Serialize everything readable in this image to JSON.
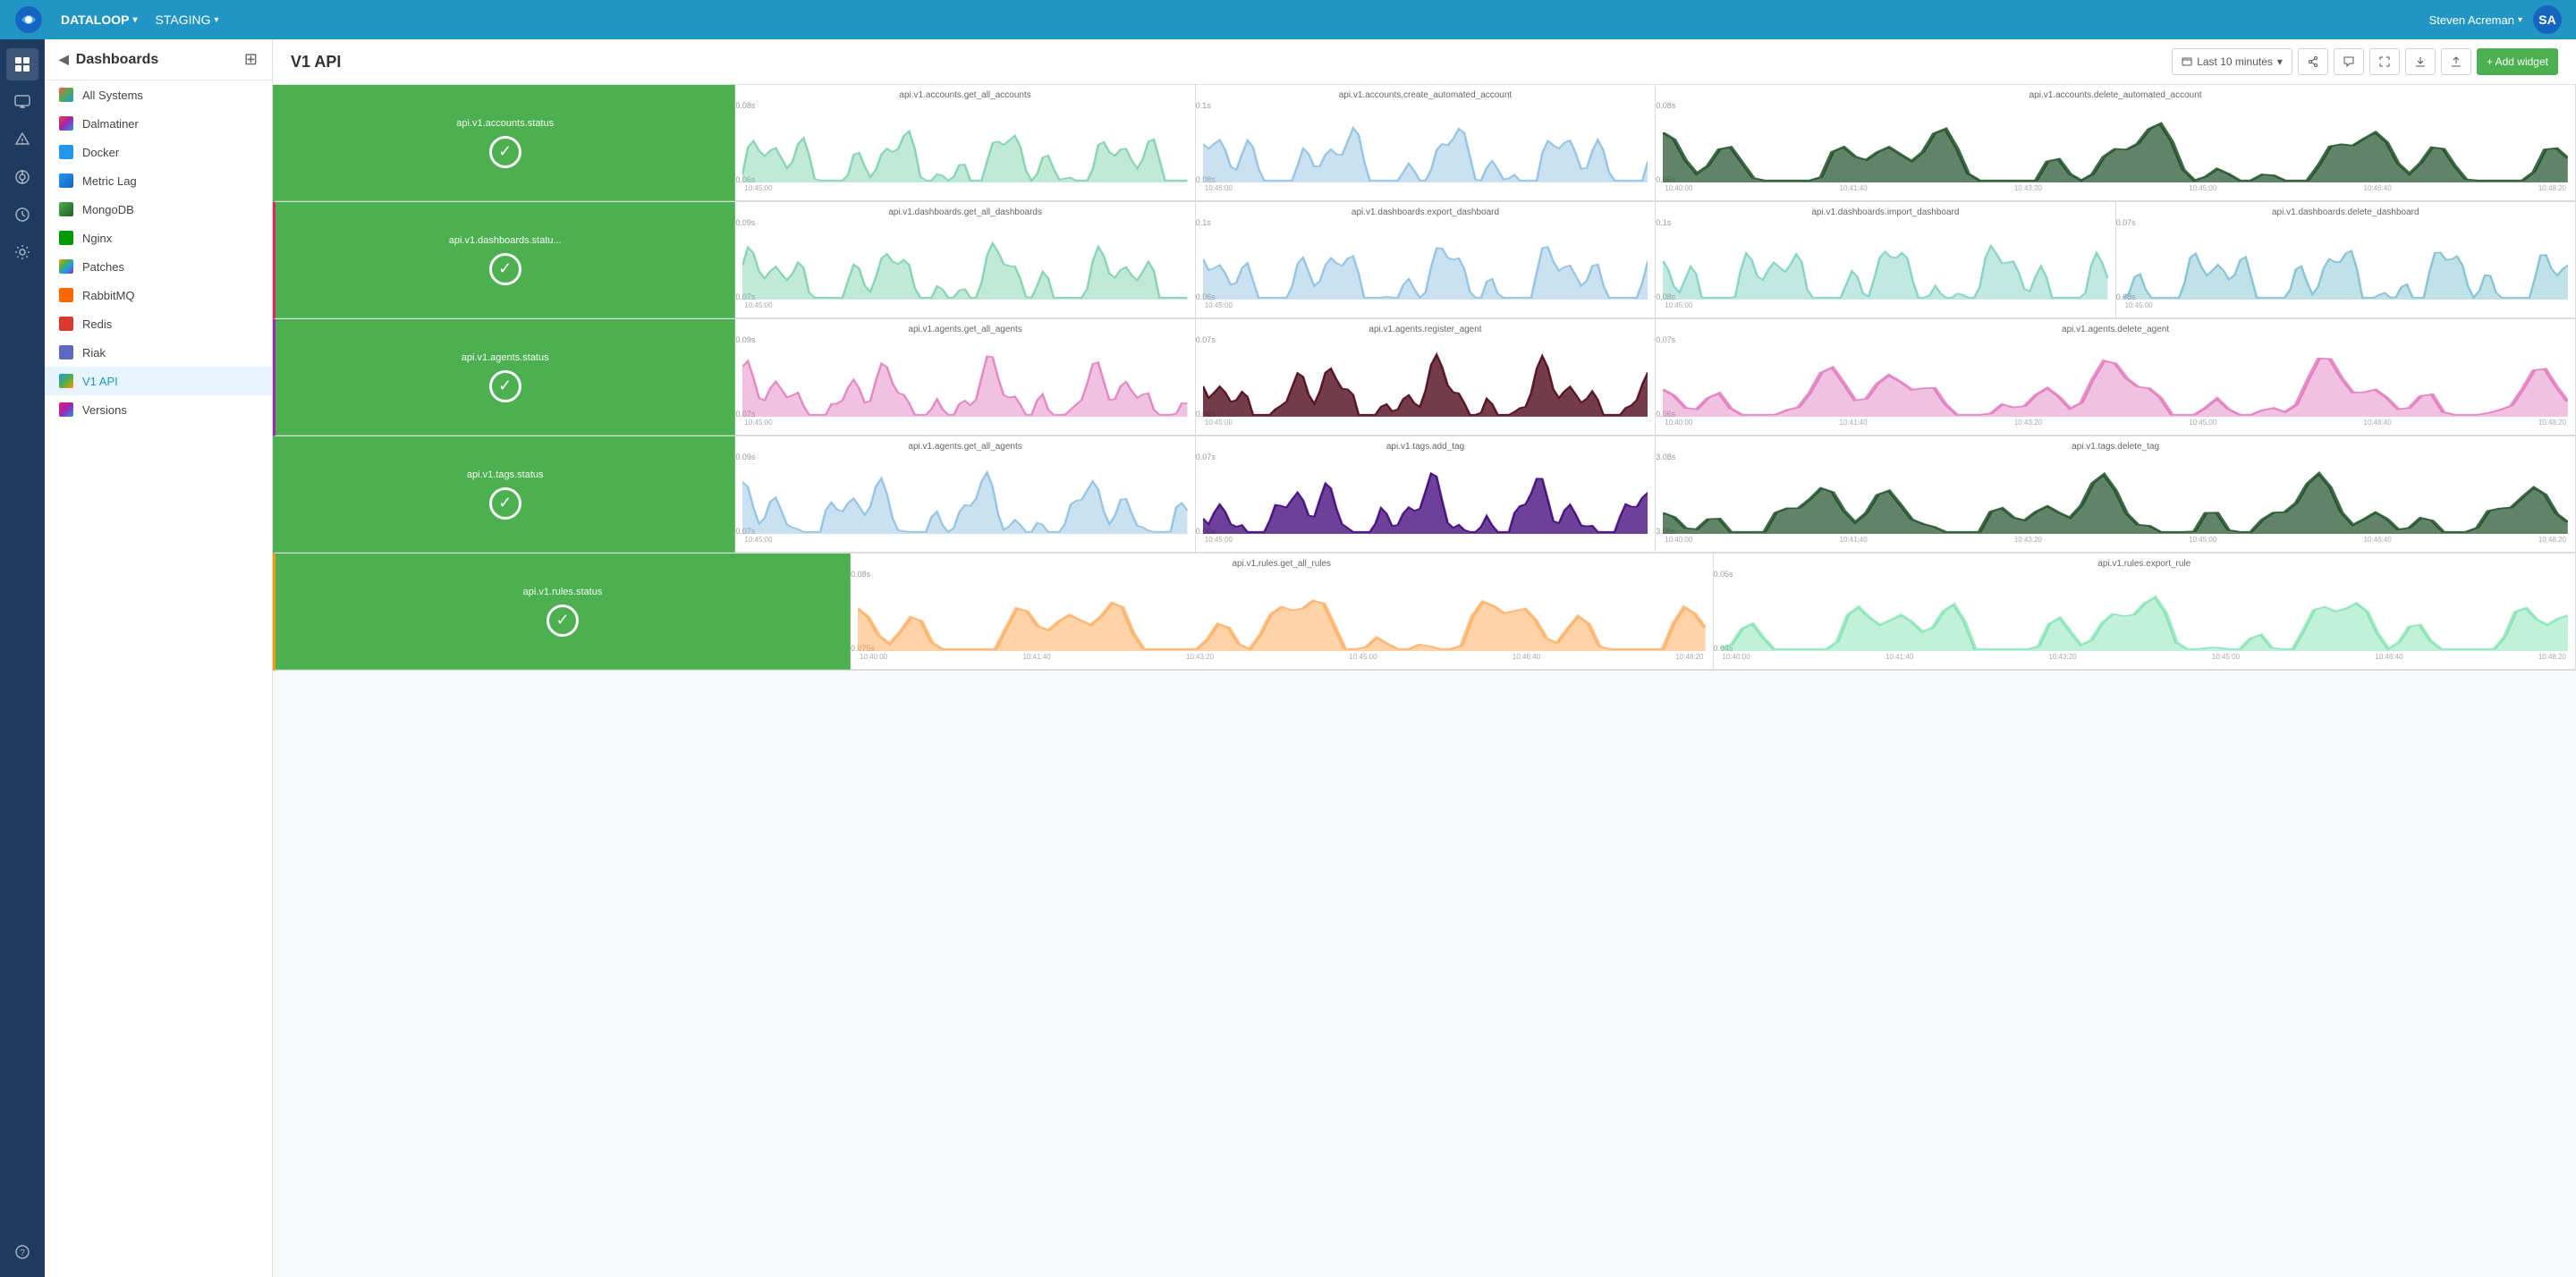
{
  "topnav": {
    "brand": "DATALOOP",
    "env": "STAGING",
    "user": "Steven Acreman",
    "chevron": "▾"
  },
  "sidebar": {
    "title": "Dashboards",
    "items": [
      {
        "id": "all-systems",
        "label": "All Systems",
        "icon": "ic-all-systems"
      },
      {
        "id": "dalmatiner",
        "label": "Dalmatiner",
        "icon": "ic-dalmatiner"
      },
      {
        "id": "docker",
        "label": "Docker",
        "icon": "ic-docker"
      },
      {
        "id": "metric-lag",
        "label": "Metric Lag",
        "icon": "ic-metric-lag"
      },
      {
        "id": "mongodb",
        "label": "MongoDB",
        "icon": "ic-mongodb"
      },
      {
        "id": "nginx",
        "label": "Nginx",
        "icon": "ic-nginx"
      },
      {
        "id": "patches",
        "label": "Patches",
        "icon": "ic-patches"
      },
      {
        "id": "rabbitmq",
        "label": "RabbitMQ",
        "icon": "ic-rabbitmq"
      },
      {
        "id": "redis",
        "label": "Redis",
        "icon": "ic-redis"
      },
      {
        "id": "riak",
        "label": "Riak",
        "icon": "ic-riak"
      },
      {
        "id": "v1api",
        "label": "V1 API",
        "icon": "ic-v1api",
        "active": true
      },
      {
        "id": "versions",
        "label": "Versions",
        "icon": "ic-versions"
      }
    ]
  },
  "toolbar": {
    "title": "V1 API",
    "time_range": "Last 10 minutes",
    "add_widget": "+ Add widget"
  },
  "dashboard": {
    "rows": [
      {
        "status": {
          "label": "api.v1.accounts.status",
          "color": "#4caf50",
          "border": "green"
        },
        "charts": [
          {
            "title": "api.v1.accounts.get_all_accounts",
            "color": "rgba(100,200,160,0.7)",
            "fill": "rgba(100,200,160,0.4)",
            "xLabels": [
              "10:45:00"
            ],
            "yTop": "0.08s",
            "yBot": "0.06s"
          },
          {
            "title": "api.v1.accounts.create_automated_account",
            "color": "rgba(120,180,220,0.7)",
            "fill": "rgba(120,180,220,0.4)",
            "xLabels": [
              "10:45:00"
            ],
            "yTop": "0.1s",
            "yBot": "0.08s"
          },
          {
            "title": "api.v1.accounts.delete_automated_account",
            "color": "rgba(30,80,40,0.85)",
            "fill": "rgba(30,80,40,0.7)",
            "xLabels": [
              "10:40:00",
              "10:41:40",
              "10:43:20",
              "10:45:00",
              "10:46:40",
              "10:48:20"
            ],
            "yTop": "0.08s",
            "yBot": "0.06s",
            "wide": true
          }
        ]
      },
      {
        "status": {
          "label": "api.v1.dashboards.statu...",
          "color": "#4caf50",
          "border": "pink"
        },
        "charts": [
          {
            "title": "api.v1.dashboards.get_all_dashboards",
            "color": "rgba(100,200,160,0.7)",
            "fill": "rgba(100,200,160,0.4)",
            "xLabels": [
              "10:45:00"
            ],
            "yTop": "0.09s",
            "yBot": "0.07s"
          },
          {
            "title": "api.v1.dashboards.export_dashboard",
            "color": "rgba(120,180,220,0.7)",
            "fill": "rgba(120,180,220,0.4)",
            "xLabels": [
              "10:45:00"
            ],
            "yTop": "0.1s",
            "yBot": "0.06s"
          },
          {
            "title": "api.v1.dashboards.import_dashboard",
            "color": "rgba(100,200,180,0.7)",
            "fill": "rgba(100,200,180,0.4)",
            "xLabels": [
              "10:45:00"
            ],
            "yTop": "0.1s",
            "yBot": "0.08s"
          },
          {
            "title": "api.v1.dashboards.delete_dashboard",
            "color": "rgba(100,180,200,0.7)",
            "fill": "rgba(100,180,200,0.4)",
            "xLabels": [
              "10:45:00"
            ],
            "yTop": "0.07s",
            "yBot": "0.08s"
          }
        ]
      },
      {
        "status": {
          "label": "api.v1.agents.status",
          "color": "#4caf50",
          "border": "violet"
        },
        "charts": [
          {
            "title": "api.v1.agents.get_all_agents",
            "color": "rgba(220,100,180,0.7)",
            "fill": "rgba(220,100,180,0.4)",
            "xLabels": [
              "10:45:00"
            ],
            "yTop": "0.09s",
            "yBot": "0.07s"
          },
          {
            "title": "api.v1.agents.register_agent",
            "color": "rgba(80,10,30,0.9)",
            "fill": "rgba(80,10,30,0.8)",
            "xLabels": [
              "10:45:00"
            ],
            "yTop": "0.07s",
            "yBot": "0.06s"
          },
          {
            "title": "api.v1.agents.delete_agent",
            "color": "rgba(220,100,180,0.7)",
            "fill": "rgba(220,100,180,0.4)",
            "xLabels": [
              "10:40:00",
              "10:41:40",
              "10:43:20",
              "10:45:00",
              "10:46:40",
              "10:48:20"
            ],
            "yTop": "0.07s",
            "yBot": "0.06s",
            "wide": true
          }
        ]
      },
      {
        "status": {
          "label": "api.v1.tags.status",
          "color": "#4caf50",
          "border": "green"
        },
        "charts": [
          {
            "title": "api.v1.agents.get_all_agents",
            "color": "rgba(120,180,220,0.7)",
            "fill": "rgba(120,180,220,0.4)",
            "xLabels": [
              "10:45:00"
            ],
            "yTop": "0.09s",
            "yBot": "0.07s"
          },
          {
            "title": "api.v1.tags.add_tag",
            "color": "rgba(60,0,120,0.85)",
            "fill": "rgba(60,0,120,0.75)",
            "xLabels": [
              "10:45:00"
            ],
            "yTop": "0.07s",
            "yBot": "0.06s"
          },
          {
            "title": "api.v1.tags.delete_tag",
            "color": "rgba(30,80,40,0.85)",
            "fill": "rgba(30,80,40,0.7)",
            "xLabels": [
              "10:40:00",
              "10:41:40",
              "10:43:20",
              "10:45:00",
              "10:46:40",
              "10:48:20"
            ],
            "yTop": "3.08s",
            "yBot": "3.06s",
            "wide": true
          }
        ]
      },
      {
        "status": {
          "label": "api.v1.rules.status",
          "color": "#4caf50",
          "border": "orange"
        },
        "charts": [
          {
            "title": "api.v1.rules.get_all_rules",
            "color": "rgba(255,165,80,0.7)",
            "fill": "rgba(255,165,80,0.5)",
            "xLabels": [
              "10:40:00",
              "10:41:40",
              "10:43:20",
              "10:45:00",
              "10:46:40",
              "10:48:20"
            ],
            "yTop": "0.08s",
            "yBot": "0.075s",
            "wide": true
          },
          {
            "title": "api.v1.rules.export_rule",
            "color": "rgba(100,220,160,0.6)",
            "fill": "rgba(100,220,160,0.4)",
            "xLabels": [
              "10:40:00",
              "10:41:40",
              "10:43:20",
              "10:45:00",
              "10:46:40",
              "10:48:20"
            ],
            "yTop": "0.05s",
            "yBot": "0.04s",
            "wide": true
          }
        ]
      }
    ]
  }
}
